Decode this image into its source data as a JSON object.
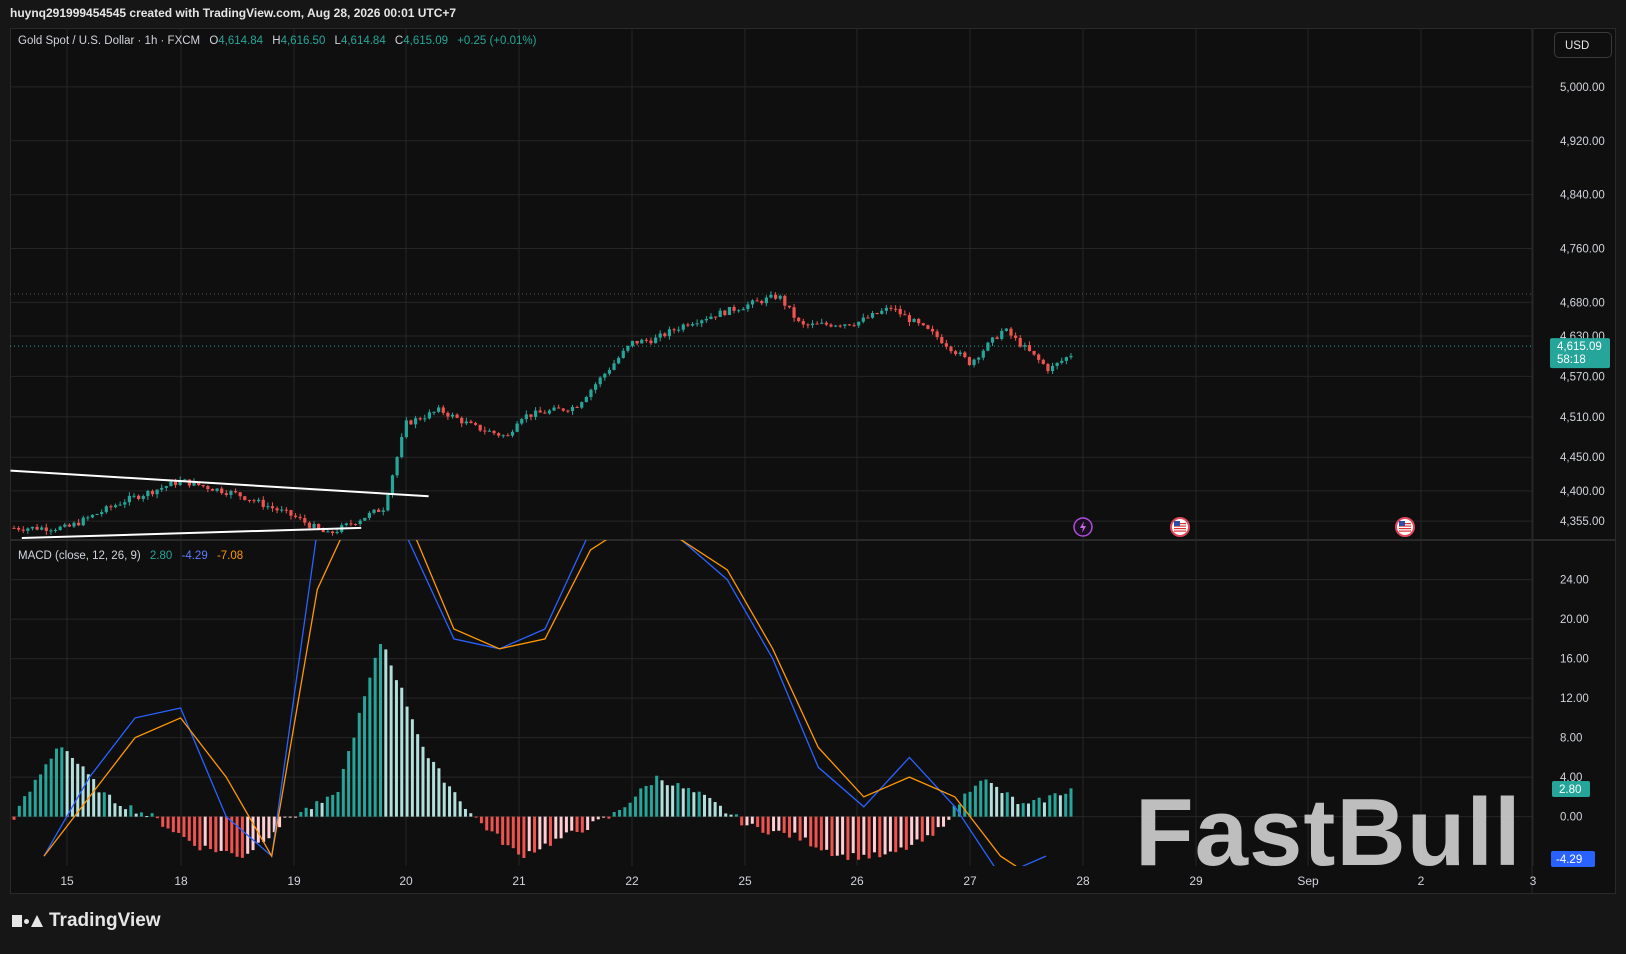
{
  "header": {
    "banner": "huynq291999454545 created with TradingView.com, Aug 28, 2026 00:01 UTC+7"
  },
  "legend": {
    "symbol": "Gold Spot / U.S. Dollar · 1h · FXCM",
    "o_label": "O",
    "o_value": "4,614.84",
    "h_label": "H",
    "h_value": "4,616.50",
    "l_label": "L",
    "l_value": "4,614.84",
    "c_label": "C",
    "c_value": "4,615.09",
    "change": "+0.25 (+0.01%)"
  },
  "currency_button": "USD",
  "macd_legend": {
    "label": "MACD (close, 12, 26, 9)",
    "hist": "2.80",
    "macd": "-4.29",
    "signal": "-7.08"
  },
  "colors": {
    "up": "#26a69a",
    "down": "#ef5350",
    "macd_line": "#2962ff",
    "signal_line": "#ff9800",
    "hist_up_strong": "#26a69a",
    "hist_up_weak": "#b2dfdb",
    "hist_down_strong": "#ef5350",
    "hist_down_weak": "#ffcdd2",
    "price_tag": "#26a69a"
  },
  "price_axis": {
    "ticks": [
      "5,000.00",
      "4,920.00",
      "4,840.00",
      "4,760.00",
      "4,680.00",
      "4,630.00",
      "4,570.00",
      "4,510.00",
      "4,450.00",
      "4,400.00",
      "4,355.00"
    ],
    "current_price": "4,615.09",
    "countdown": "58:18"
  },
  "macd_axis": {
    "ticks": [
      "24.00",
      "20.00",
      "16.00",
      "12.00",
      "8.00",
      "4.00",
      "0.00"
    ],
    "hist_tag": "2.80",
    "macd_tag": "-4.29"
  },
  "time_axis": {
    "ticks": [
      "15",
      "18",
      "19",
      "20",
      "21",
      "22",
      "25",
      "26",
      "27",
      "28",
      "29",
      "Sep",
      "2",
      "3"
    ]
  },
  "event_icons": [
    "lightning-icon",
    "us-flag-icon",
    "us-flag-icon"
  ],
  "footer": {
    "logo_text": "TradingView"
  },
  "watermark": "FastBull",
  "chart_data": [
    {
      "type": "candlestick",
      "title": "Gold Spot / U.S. Dollar · 1h · FXCM",
      "x_ticks": [
        "15",
        "18",
        "19",
        "20",
        "21",
        "22",
        "25",
        "26",
        "27",
        "28",
        "29",
        "Sep",
        "2",
        "3"
      ],
      "y_range": [
        4330,
        5040
      ],
      "close_path": [
        {
          "x": "15",
          "y": 4345
        },
        {
          "x": "15.5",
          "y": 4385
        },
        {
          "x": "18",
          "y": 4415
        },
        {
          "x": "18.5",
          "y": 4395
        },
        {
          "x": "19",
          "y": 4362
        },
        {
          "x": "19.3",
          "y": 4335
        },
        {
          "x": "19.8",
          "y": 4375
        },
        {
          "x": "20",
          "y": 4500
        },
        {
          "x": "20.3",
          "y": 4520
        },
        {
          "x": "20.6",
          "y": 4495
        },
        {
          "x": "20.9",
          "y": 4480
        },
        {
          "x": "21",
          "y": 4510
        },
        {
          "x": "21.5",
          "y": 4525
        },
        {
          "x": "22",
          "y": 4620
        },
        {
          "x": "22.2",
          "y": 4625
        },
        {
          "x": "22.5",
          "y": 4650
        },
        {
          "x": "25",
          "y": 4675
        },
        {
          "x": "25.3",
          "y": 4690
        },
        {
          "x": "25.5",
          "y": 4645
        },
        {
          "x": "26",
          "y": 4650
        },
        {
          "x": "26.3",
          "y": 4672
        },
        {
          "x": "26.7",
          "y": 4630
        },
        {
          "x": "27",
          "y": 4590
        },
        {
          "x": "27.3",
          "y": 4640
        },
        {
          "x": "27.7",
          "y": 4580
        },
        {
          "x": "28",
          "y": 4615
        }
      ],
      "trendlines": [
        {
          "from": {
            "x": "14.5",
            "y": 4430
          },
          "to": {
            "x": "20.2",
            "y": 4392
          }
        },
        {
          "from": {
            "x": "14.6",
            "y": 4330
          },
          "to": {
            "x": "19.6",
            "y": 4345
          }
        }
      ],
      "last_price": 4615.09
    },
    {
      "type": "line",
      "title": "MACD (close, 12, 26, 9)",
      "y_range": [
        -5,
        27
      ],
      "series": [
        {
          "name": "MACD",
          "values": [
            -4,
            4,
            10,
            11,
            0,
            -4,
            29,
            35,
            28,
            18,
            17,
            19,
            29,
            31,
            28,
            24,
            16,
            5,
            1,
            6,
            1,
            -6,
            -4
          ]
        },
        {
          "name": "Signal",
          "values": [
            -4,
            2,
            8,
            10,
            4,
            -4,
            23,
            33,
            30,
            19,
            17,
            18,
            27,
            30,
            28,
            25,
            17,
            7,
            2,
            4,
            2,
            -4,
            -7
          ]
        }
      ],
      "histogram": [
        0,
        7.5,
        2,
        0,
        -3,
        -4,
        0,
        2,
        18,
        6,
        0,
        -4,
        -2,
        0,
        4,
        2,
        -1,
        -2,
        -4,
        -4,
        -2,
        4,
        1,
        2.8
      ],
      "last_values": {
        "hist": 2.8,
        "macd": -4.29,
        "signal": -7.08
      }
    }
  ]
}
